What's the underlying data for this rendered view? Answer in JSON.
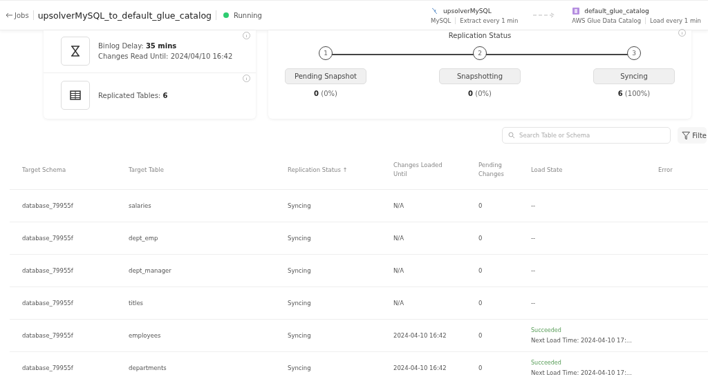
{
  "header": {
    "back_label": "Jobs",
    "title": "upsolverMySQL_to_default_glue_catalog",
    "status": "Running",
    "running": true,
    "source": {
      "name": "upsolverMySQL",
      "type": "MySQL",
      "schedule": "Extract every 1 min"
    },
    "target": {
      "name": "default_glue_catalog",
      "type": "AWS Glue Data Catalog",
      "schedule": "Load every 1 min"
    }
  },
  "metrics": [
    {
      "kind": "delay",
      "lines": [
        "Binlog Delay: **35 mins**",
        "Changes Read Until: 2024/04/10 16:42"
      ]
    },
    {
      "kind": "tables",
      "lines": [
        "Replicated Tables: **6**"
      ]
    }
  ],
  "replication": {
    "title": "Replication Status",
    "steps": [
      {
        "number": "1",
        "label": "Pending Snapshot",
        "count": "**0** (0%)"
      },
      {
        "number": "2",
        "label": "Snapshotting",
        "count": "**0** (0%)"
      },
      {
        "number": "3",
        "label": "Syncing",
        "count": "**6** (100%)"
      }
    ]
  },
  "search": {
    "placeholder": "Search Table or Schema"
  },
  "filter_label": "Filte",
  "table": {
    "columns": [
      "Target Schema",
      "Target Table",
      "Replication Status ↑",
      "Changes Loaded Until",
      "Pending Changes",
      "Load State",
      "Error"
    ],
    "rows": [
      {
        "schema": "database_79955f",
        "table": "salaries",
        "status": "Syncing",
        "loaded_until": "N/A",
        "pending": "0",
        "load_state": {
          "kind": "none",
          "text": "--"
        }
      },
      {
        "schema": "database_79955f",
        "table": "dept_emp",
        "status": "Syncing",
        "loaded_until": "N/A",
        "pending": "0",
        "load_state": {
          "kind": "none",
          "text": "--"
        }
      },
      {
        "schema": "database_79955f",
        "table": "dept_manager",
        "status": "Syncing",
        "loaded_until": "N/A",
        "pending": "0",
        "load_state": {
          "kind": "none",
          "text": "--"
        }
      },
      {
        "schema": "database_79955f",
        "table": "titles",
        "status": "Syncing",
        "loaded_until": "N/A",
        "pending": "0",
        "load_state": {
          "kind": "none",
          "text": "--"
        }
      },
      {
        "schema": "database_79955f",
        "table": "employees",
        "status": "Syncing",
        "loaded_until": "2024-04-10 16:42",
        "pending": "0",
        "load_state": {
          "kind": "succeeded",
          "text": "Succeeded",
          "next": "Next Load Time: 2024-04-10 17:..."
        }
      },
      {
        "schema": "database_79955f",
        "table": "departments",
        "status": "Syncing",
        "loaded_until": "2024-04-10 16:42",
        "pending": "0",
        "load_state": {
          "kind": "succeeded",
          "text": "Succeeded",
          "next": "Next Load Time: 2024-04-10 17:..."
        }
      }
    ]
  }
}
